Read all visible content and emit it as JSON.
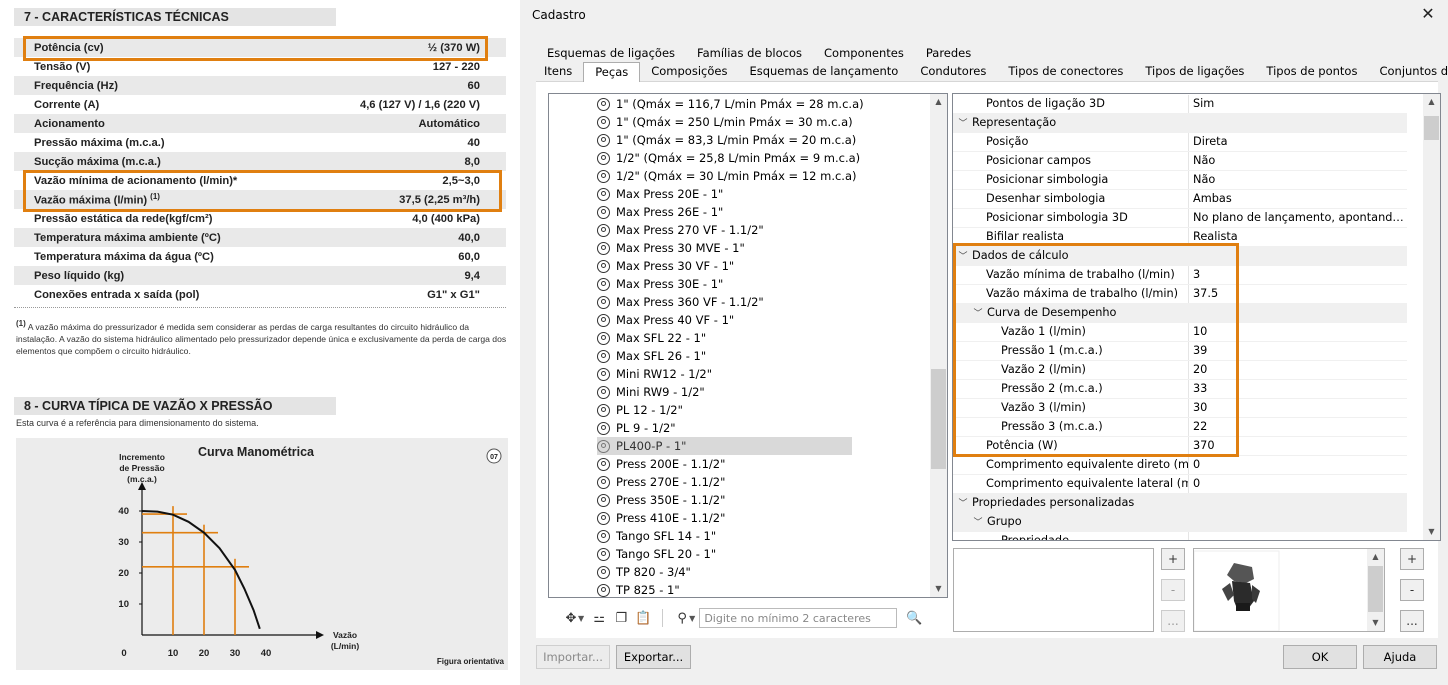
{
  "datasheet": {
    "spec_title": "7 - CARACTERÍSTICAS TÉCNICAS",
    "specs": [
      {
        "label": "Potência (cv)",
        "value": "½ (370 W)"
      },
      {
        "label": "Tensão (V)",
        "value": "127 - 220"
      },
      {
        "label": "Frequência (Hz)",
        "value": "60"
      },
      {
        "label": "Corrente (A)",
        "value": "4,6 (127 V) / 1,6 (220 V)"
      },
      {
        "label": "Acionamento",
        "value": "Automático"
      },
      {
        "label": "Pressão máxima (m.c.a.)",
        "value": "40"
      },
      {
        "label": "Sucção máxima (m.c.a.)",
        "value": "8,0"
      },
      {
        "label": "Vazão mínima de acionamento (l/min)*",
        "value": "2,5~3,0"
      },
      {
        "label": "Vazão máxima (l/min)",
        "label_sup": "(1)",
        "value": "37,5 (2,25 m³/h)"
      },
      {
        "label": "Pressão estática da rede(kgf/cm²)",
        "value": "4,0 (400 kPa)"
      },
      {
        "label": "Temperatura máxima ambiente (ºC)",
        "value": "40,0"
      },
      {
        "label": "Temperatura máxima da água (ºC)",
        "value": "60,0"
      },
      {
        "label": "Peso líquido (kg)",
        "value": "9,4"
      },
      {
        "label": "Conexões entrada x saída (pol)",
        "value": "G1\" x G1\""
      }
    ],
    "footnote_mark": "(1)",
    "footnote": "A vazão máxima do pressurizador é medida sem considerar as perdas de carga resultantes do circuito hidráulico da instalação. A vazão do sistema hidráulico alimentado pelo pressurizador depende única e exclusivamente da perda de carga dos elementos que compõem o circuito hidráulico.",
    "curve_title_section": "8 - CURVA TÍPICA DE VAZÃO X PRESSÃO",
    "curve_note": "Esta curva é a referência para dimensionamento do sistema.",
    "chart_data": {
      "type": "line",
      "title": "Curva Manométrica",
      "ylabel_lines": [
        "Incremento",
        "de Pressão",
        "(m.c.a.)"
      ],
      "xlabel_lines": [
        "Vazão",
        "(L/min)"
      ],
      "x_ticks": [
        "0",
        "10",
        "20",
        "30",
        "40"
      ],
      "y_ticks": [
        "10",
        "20",
        "30",
        "40"
      ],
      "xlim": [
        0,
        45
      ],
      "ylim": [
        0,
        45
      ],
      "series": [
        {
          "x": [
            0,
            5,
            10,
            15,
            20,
            25,
            30,
            33,
            36,
            38
          ],
          "values": [
            40,
            39.8,
            38.8,
            36.5,
            33,
            28,
            21,
            15,
            8,
            2
          ]
        }
      ],
      "reference_points": [
        {
          "x": 10,
          "y": 39
        },
        {
          "x": 20,
          "y": 33
        },
        {
          "x": 30,
          "y": 22
        }
      ],
      "badge": "07",
      "footer_label": "Figura orientativa",
      "curve_color": "#111111",
      "reference_color": "#e07f10"
    }
  },
  "dialog": {
    "title": "Cadastro",
    "close_glyph": "✕",
    "tabs_row1": [
      "Esquemas de ligações",
      "Famílias de blocos",
      "Componentes",
      "Paredes"
    ],
    "tabs_row2": [
      "Itens",
      "Peças",
      "Composições",
      "Esquemas de lançamento",
      "Condutores",
      "Tipos de conectores",
      "Tipos de ligações",
      "Tipos de pontos",
      "Conjuntos de pontos"
    ],
    "active_tab": "Peças",
    "tree_items": [
      "1\" (Qmáx = 116,7 L/min Pmáx = 28 m.c.a)",
      "1\" (Qmáx = 250 L/min Pmáx = 30 m.c.a)",
      "1\" (Qmáx = 83,3 L/min Pmáx = 20 m.c.a)",
      "1/2\" (Qmáx = 25,8 L/min Pmáx = 9 m.c.a)",
      "1/2\" (Qmáx = 30 L/min Pmáx = 12 m.c.a)",
      "Max Press 20E - 1\"",
      "Max Press 26E - 1\"",
      "Max Press 270 VF - 1.1/2\"",
      "Max Press 30 MVE - 1\"",
      "Max Press 30 VF - 1\"",
      "Max Press 30E - 1\"",
      "Max Press 360 VF - 1.1/2\"",
      "Max Press 40 VF - 1\"",
      "Max SFL 22 - 1\"",
      "Max SFL 26 - 1\"",
      "Mini RW12 - 1/2\"",
      "Mini RW9 - 1/2\"",
      "PL 12 - 1/2\"",
      "PL 9 - 1/2\"",
      "PL400-P - 1\"",
      "Press 200E - 1.1/2\"",
      "Press 270E - 1.1/2\"",
      "Press 350E - 1.1/2\"",
      "Press 410E - 1.1/2\"",
      "Tango SFL 14 - 1\"",
      "Tango SFL 20 - 1\"",
      "TP 820 - 3/4\"",
      "TP 825 - 1\""
    ],
    "selected_item": "PL400-P - 1\"",
    "search_placeholder": "Digite no mínimo 2 caracteres",
    "properties": [
      {
        "name": "Pontos de ligação 3D",
        "value": "Sim",
        "level": 1
      },
      {
        "name": "Representação",
        "level": 0,
        "category": true
      },
      {
        "name": "Posição",
        "value": "Direta",
        "level": 1
      },
      {
        "name": "Posicionar campos",
        "value": "Não",
        "level": 1
      },
      {
        "name": "Posicionar simbologia",
        "value": "Não",
        "level": 1
      },
      {
        "name": "Desenhar simbologia",
        "value": "Ambas",
        "level": 1
      },
      {
        "name": "Posicionar simbologia 3D",
        "value": "No plano de lançamento, apontando para...",
        "level": 1
      },
      {
        "name": "Bifilar realista",
        "value": "Realista",
        "level": 1
      },
      {
        "name": "Dados de cálculo",
        "level": 0,
        "category": true
      },
      {
        "name": "Vazão mínima de trabalho (l/min)",
        "value": "3",
        "level": 1
      },
      {
        "name": "Vazão máxima de trabalho (l/min)",
        "value": "37.5",
        "level": 1
      },
      {
        "name": "Curva de Desempenho",
        "level": 1,
        "category": true
      },
      {
        "name": "Vazão 1 (l/min)",
        "value": "10",
        "level": 2
      },
      {
        "name": "Pressão 1 (m.c.a.)",
        "value": "39",
        "level": 2
      },
      {
        "name": "Vazão 2 (l/min)",
        "value": "20",
        "level": 2
      },
      {
        "name": "Pressão 2 (m.c.a.)",
        "value": "33",
        "level": 2
      },
      {
        "name": "Vazão 3 (l/min)",
        "value": "30",
        "level": 2
      },
      {
        "name": "Pressão 3 (m.c.a.)",
        "value": "22",
        "level": 2
      },
      {
        "name": "Potência (W)",
        "value": "370",
        "level": 1
      },
      {
        "name": "Comprimento equivalente direto (m)",
        "value": "0",
        "level": 1
      },
      {
        "name": "Comprimento equivalente lateral (m)",
        "value": "0",
        "level": 1
      },
      {
        "name": "Propriedades personalizadas",
        "level": 0,
        "category": true
      },
      {
        "name": "Grupo",
        "level": 1,
        "category": true
      },
      {
        "name": "Propriedade",
        "value": "",
        "level": 2
      }
    ],
    "side_buttons": {
      "add": "+",
      "remove": "-",
      "more": "..."
    },
    "buttons": {
      "import": "Importar...",
      "export": "Exportar...",
      "ok": "OK",
      "help": "Ajuda"
    },
    "highlight_color": "#e07f10"
  }
}
